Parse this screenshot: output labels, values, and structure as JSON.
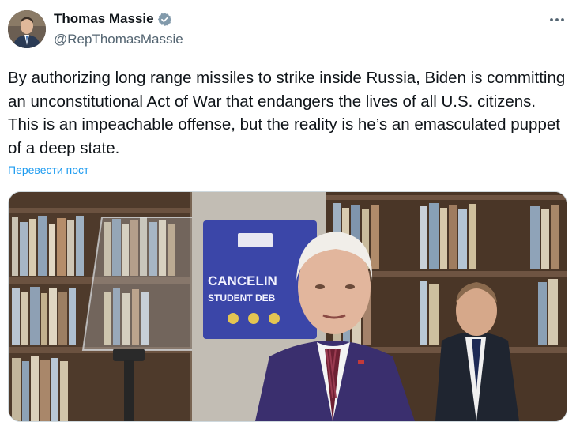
{
  "author": {
    "name": "Thomas Massie",
    "handle": "@RepThomasMassie",
    "verified": true
  },
  "tweet": {
    "text": "By authorizing long range missiles to strike inside Russia, Biden is committing  an unconstitutional Act of War that endangers the lives of all U.S. citizens. This is an impeachable offense, but the reality is he’s an emasculated puppet of a deep state.",
    "translate_label": "Перевести пост"
  },
  "media": {
    "sign_lines": [
      "CANCELIN",
      "STUDENT DEB"
    ]
  },
  "colors": {
    "link": "#1d9bf0",
    "verified": "#829aab",
    "secondary_text": "#536471"
  }
}
